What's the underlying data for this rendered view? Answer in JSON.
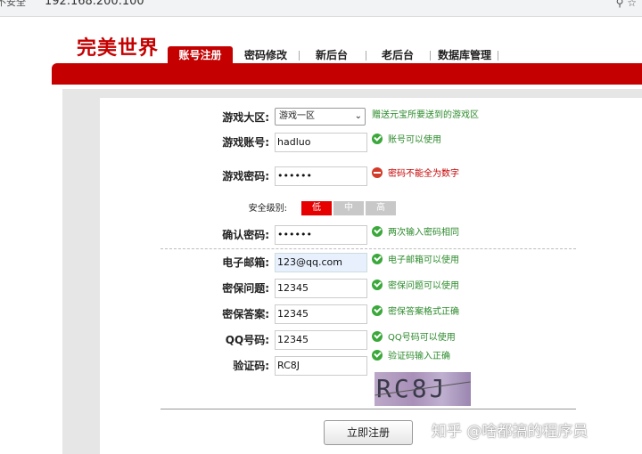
{
  "browser": {
    "security": "不安全",
    "url": "192.168.200.100"
  },
  "site": {
    "logo": "完美世界",
    "tabs": [
      "账号注册",
      "密码修改",
      "新后台",
      "老后台",
      "数据库管理"
    ]
  },
  "form": {
    "server": {
      "label": "游戏大区:",
      "value": "游戏一区",
      "hint": "赠送元宝所要送到的游戏区"
    },
    "account": {
      "label": "游戏账号:",
      "value": "hadluo",
      "hint": "账号可以使用"
    },
    "password": {
      "label": "游戏密码:",
      "value": "••••••",
      "hint": "密码不能全为数字"
    },
    "strength": {
      "label": "安全级别:",
      "low": "低",
      "mid": "中",
      "high": "高"
    },
    "confirm": {
      "label": "确认密码:",
      "value": "••••••",
      "hint": "两次输入密码相同"
    },
    "email": {
      "label": "电子邮箱:",
      "value": "123@qq.com",
      "hint": "电子邮箱可以使用"
    },
    "question": {
      "label": "密保问题:",
      "value": "12345",
      "hint": "密保问题可以使用"
    },
    "answer": {
      "label": "密保答案:",
      "value": "12345",
      "hint": "密保答案格式正确"
    },
    "qq": {
      "label": "QQ号码:",
      "value": "12345",
      "hint": "QQ号码可以使用"
    },
    "captcha": {
      "label": "验证码:",
      "value": "RC8J",
      "hint": "验证码输入正确",
      "image_text": "RC8J"
    },
    "submit": "立即注册"
  },
  "watermark": "知乎 @啥都搞的程序员",
  "colors": {
    "brand_red": "#c40000",
    "ok_green": "#3aa83a"
  }
}
